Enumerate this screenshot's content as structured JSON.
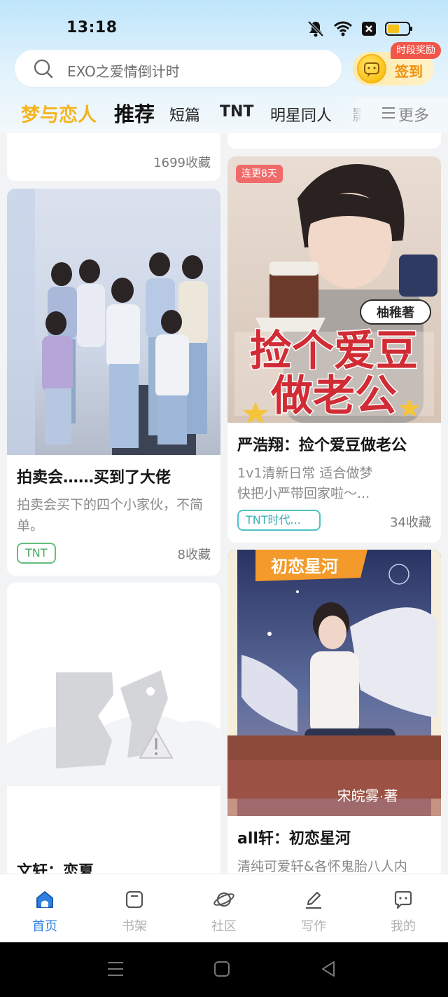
{
  "status_bar": {
    "time": "13:18",
    "icons": [
      "mute-icon",
      "wifi-icon",
      "sim-off-icon",
      "battery-icon"
    ],
    "battery_color": "#f4c11b"
  },
  "search": {
    "placeholder": "EXO之爱情倒计时"
  },
  "checkin": {
    "label": "签到",
    "badge": "时段奖励"
  },
  "tabs": {
    "brand": "梦与恋人",
    "active": "推荐",
    "items": [
      "短篇",
      "TNT",
      "明星同人",
      "影"
    ],
    "more": "更多"
  },
  "feed": {
    "left": [
      {
        "fav": "1699收藏"
      },
      {
        "title": "拍卖会……买到了大佬",
        "desc": "拍卖会买下的四个小家伙，不简单。",
        "tag": "TNT",
        "fav": "8收藏"
      },
      {
        "title": "文轩：恋夏"
      }
    ],
    "right": [
      {
        "badge": "连更8天",
        "cover_text": [
          "捡个爱豆",
          "做老公"
        ],
        "cover_stamp": "柚稚著",
        "title": "严浩翔：捡个爱豆做老公",
        "desc_line1": "1v1清新日常 适合做梦",
        "desc_line2": "快把小严带回家啦～...",
        "tag": "TNT时代...",
        "fav": "34收藏"
      },
      {
        "cover_text": "初恋星河",
        "cover_stamp": "宋皖雾·著",
        "title": "all轩：初恋星河",
        "desc": "清纯可爱轩&各怀鬼胎八人内"
      }
    ]
  },
  "bottom_nav": [
    {
      "label": "首页",
      "icon": "home-icon",
      "active": true
    },
    {
      "label": "书架",
      "icon": "bookshelf-icon",
      "active": false
    },
    {
      "label": "社区",
      "icon": "planet-icon",
      "active": false
    },
    {
      "label": "写作",
      "icon": "pen-icon",
      "active": false
    },
    {
      "label": "我的",
      "icon": "chat-bubble-icon",
      "active": false
    }
  ],
  "colors": {
    "accent": "#2d7fe0",
    "brand_tab": "#f4b521",
    "tag_teal": "#39b0b4",
    "tag_green": "#4aa864",
    "badge_red": "#f06a6a"
  }
}
